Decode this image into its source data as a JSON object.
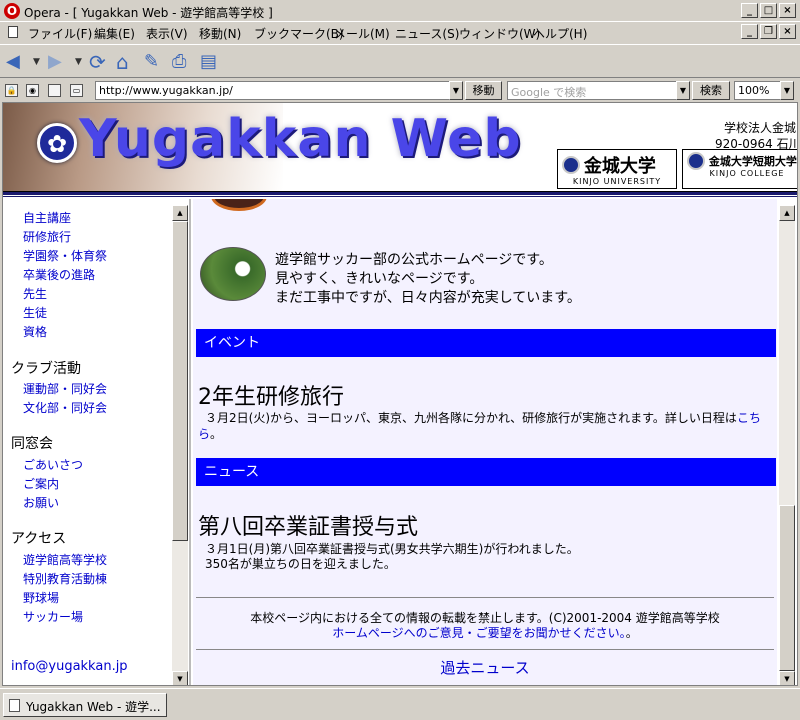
{
  "window": {
    "app_icon": "opera-logo-icon",
    "title": "Opera - [ Yugakkan Web - 遊学館高等学校 ]",
    "controls": [
      "minimize-icon",
      "maximize-icon",
      "close-icon"
    ]
  },
  "menubar": {
    "items": [
      "ファイル(F)",
      "編集(E)",
      "表示(V)",
      "移動(N)",
      "ブックマーク(B)",
      "メール(M)",
      "ニュース(S)",
      "ウィンドウ(W)",
      "ヘルプ(H)"
    ]
  },
  "toolbar": {
    "icons": [
      "back-icon",
      "back-dropdown-icon",
      "forward-icon",
      "forward-dropdown-icon",
      "reload-icon",
      "home-icon",
      "hotlist-icon",
      "print-icon",
      "page-icon"
    ]
  },
  "address": {
    "url": "http://www.yugakkan.jp/",
    "go_label": "移動",
    "search_placeholder": "Google で検索",
    "search_label": "検索",
    "zoom": "100%"
  },
  "banner": {
    "title": "Yugakkan Web",
    "corp_name": "学校法人金城",
    "corp_address": "920-0964 石川",
    "uni1_name": "金城大学",
    "uni1_sub": "KINJO UNIVERSITY",
    "uni2_name": "金城大学短期大学部",
    "uni2_sub": "KINJO COLLEGE"
  },
  "sidebar": {
    "school_links": [
      "自主講座",
      "研修旅行",
      "学園祭・体育祭",
      "卒業後の進路",
      "先生",
      "生徒",
      "資格"
    ],
    "club_heading": "クラブ活動",
    "club_links": [
      "運動部・同好会",
      "文化部・同好会"
    ],
    "alumni_heading": "同窓会",
    "alumni_links": [
      "ごあいさつ",
      "ご案内",
      "お願い"
    ],
    "access_heading": "アクセス",
    "access_links": [
      "遊学館高等学校",
      "特別教育活動棟",
      "野球場",
      "サッカー場"
    ],
    "email": "info@yugakkan.jp"
  },
  "content": {
    "intro_lines": [
      "遊学館サッカー部の公式ホームページです。",
      "見やすく、きれいなページです。",
      "まだ工事中ですが、日々内容が充実しています。"
    ],
    "event_heading": "イベント",
    "event_title": "2年生研修旅行",
    "event_body": "３月2日(火)から、ヨーロッパ、東京、九州各隊に分かれ、研修旅行が実施されます。詳しい日程は",
    "event_link_1": "こち",
    "event_link_2": "ら",
    "event_end": "。",
    "news_heading": "ニュース",
    "news_title": "第八回卒業証書授与式",
    "news_body_1": "３月1日(月)第八回卒業証書授与式(男女共学六期生)が行われました。",
    "news_body_2": "350名が巣立ちの日を迎えました。",
    "copyright": "本校ページ内における全ての情報の転載を禁止します。(C)2001-2004 遊学館高等学校",
    "feedback_link": "ホームページへのご意見・ご要望をお聞かせください。",
    "feedback_end": "。",
    "past_news": "過去ニュース"
  },
  "statusbar": {
    "tab_label": "Yugakkan Web - 遊学..."
  }
}
